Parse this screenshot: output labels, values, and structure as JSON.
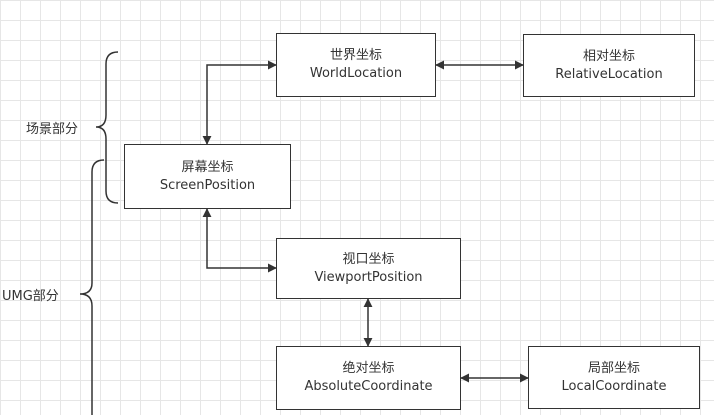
{
  "groups": {
    "scene": "场景部分",
    "umg": "UMG部分"
  },
  "nodes": {
    "world": {
      "title": "世界坐标",
      "subtitle": "WorldLocation"
    },
    "relative": {
      "title": "相对坐标",
      "subtitle": "RelativeLocation"
    },
    "screen": {
      "title": "屏幕坐标",
      "subtitle": "ScreenPosition"
    },
    "viewport": {
      "title": "视口坐标",
      "subtitle": "ViewportPosition"
    },
    "absolute": {
      "title": "绝对坐标",
      "subtitle": "AbsoluteCoordinate"
    },
    "local": {
      "title": "局部坐标",
      "subtitle": "LocalCoordinate"
    }
  }
}
